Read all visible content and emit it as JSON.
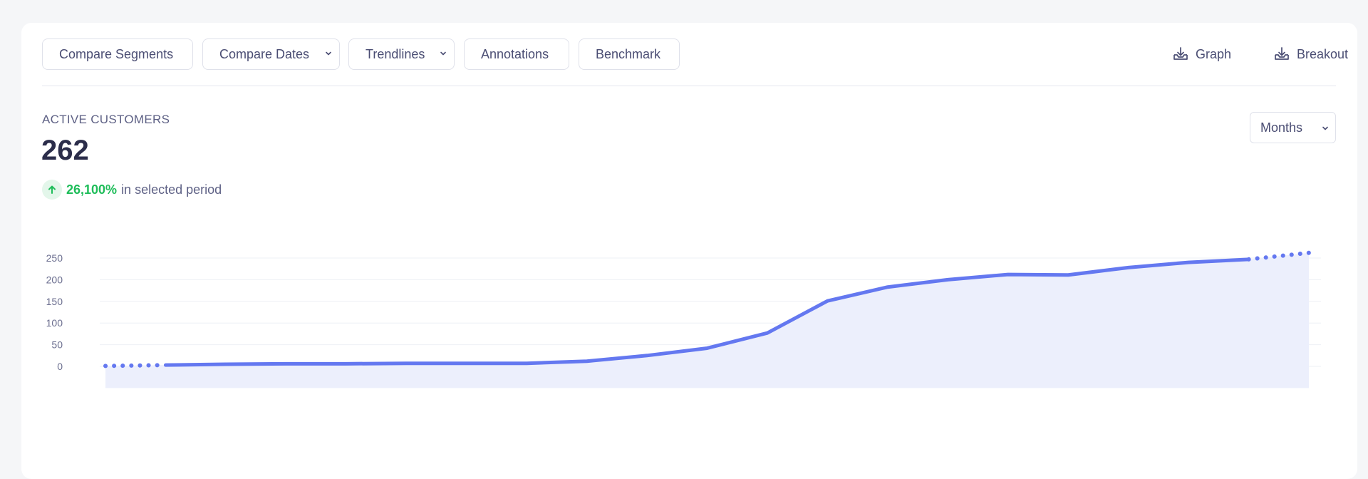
{
  "toolbar": {
    "buttons": [
      {
        "label": "Compare Segments",
        "dropdown": false
      },
      {
        "label": "Compare Dates",
        "dropdown": true
      },
      {
        "label": "Trendlines",
        "dropdown": true
      },
      {
        "label": "Annotations",
        "dropdown": false
      },
      {
        "label": "Benchmark",
        "dropdown": false
      }
    ],
    "export_graph_label": "Graph",
    "export_breakout_label": "Breakout"
  },
  "metric": {
    "label": "ACTIVE CUSTOMERS",
    "value": "262",
    "change_pct": "26,100%",
    "change_suffix": "in selected period"
  },
  "period_select": {
    "value": "Months"
  },
  "colors": {
    "line": "#6478f0",
    "area": "#eceffc",
    "positive": "#1fbd5a"
  },
  "chart_data": {
    "type": "line",
    "title": "",
    "xlabel": "",
    "ylabel": "",
    "ylim": [
      -50,
      250
    ],
    "yticks": [
      250,
      200,
      150,
      100,
      50,
      0
    ],
    "grid": true,
    "series": [
      {
        "values": [
          1,
          3,
          5,
          6,
          6,
          7,
          7,
          7,
          12,
          25,
          42,
          77,
          151,
          183,
          200,
          212,
          211,
          228,
          240,
          247,
          262
        ],
        "dotted_start_segments": 1,
        "dotted_end_segments": 1
      }
    ]
  }
}
